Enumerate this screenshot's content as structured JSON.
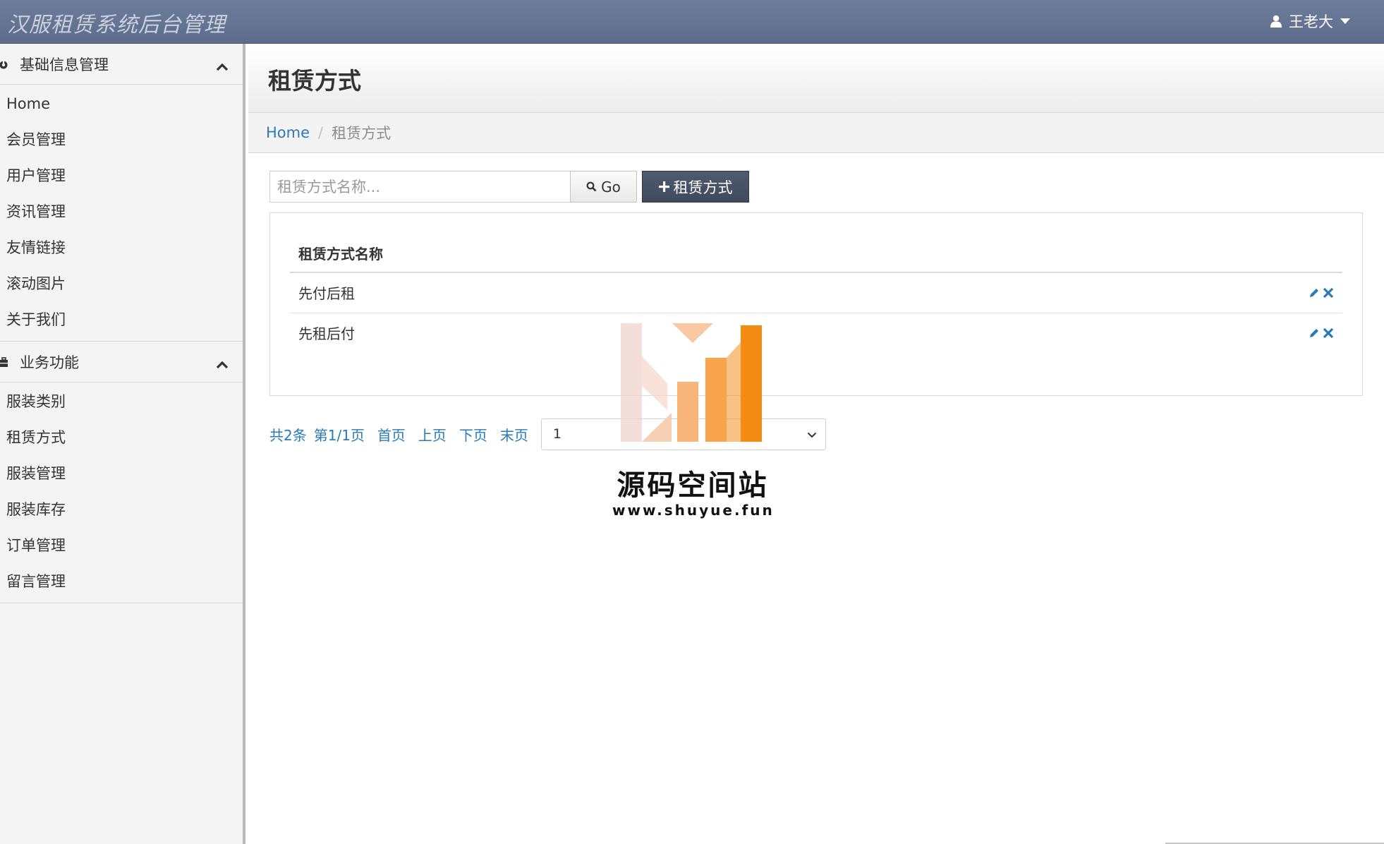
{
  "app": {
    "title": "汉服租赁系统后台管理",
    "user_name": "王老大"
  },
  "sidebar": {
    "groups": [
      {
        "label": "基础信息管理",
        "items": [
          "Home",
          "会员管理",
          "用户管理",
          "资讯管理",
          "友情链接",
          "滚动图片",
          "关于我们"
        ]
      },
      {
        "label": "业务功能",
        "items": [
          "服装类别",
          "租赁方式",
          "服装管理",
          "服装库存",
          "订单管理",
          "留言管理"
        ]
      }
    ]
  },
  "page": {
    "title": "租赁方式",
    "breadcrumb": {
      "home": "Home",
      "current": "租赁方式"
    }
  },
  "search": {
    "placeholder": "租赁方式名称...",
    "value": "",
    "go_label": "Go",
    "add_label": "租赁方式"
  },
  "table": {
    "header": "租赁方式名称",
    "rows": [
      {
        "name": "先付后租"
      },
      {
        "name": "先租后付"
      }
    ]
  },
  "pagination": {
    "total": "共2条",
    "page_info": "第1/1页",
    "first": "首页",
    "prev": "上页",
    "next": "下页",
    "last": "末页",
    "selected_page": "1"
  },
  "watermark": {
    "title": "源码空间站",
    "url": "www.shuyue.fun"
  },
  "colors": {
    "topbar": "#5d6c8b",
    "link": "#2a7ab8",
    "add_button": "#444f63",
    "action_icon": "#2a7ab8",
    "watermark_orange": "#f7941d"
  },
  "icons": {
    "user": "user-icon",
    "caret": "caret-down-icon",
    "group1": "dashboard-icon",
    "group2": "briefcase-icon",
    "collapse": "chevron-up-icon",
    "search": "search-icon",
    "add": "plus-icon",
    "edit": "pencil-icon",
    "delete": "close-icon",
    "select": "chevron-down-icon"
  }
}
